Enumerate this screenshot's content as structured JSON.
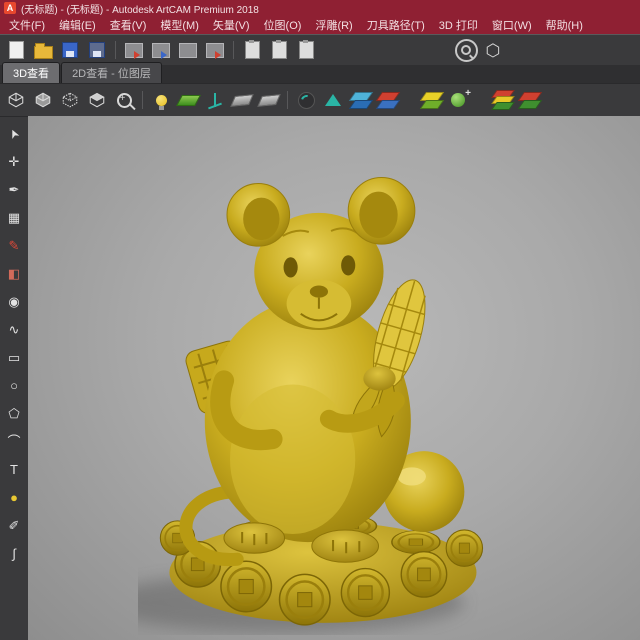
{
  "colors": {
    "titlebar": "#8f2033",
    "toolbar_bg": "#3a3a3c",
    "viewport_gray": "#a9a9a9",
    "model_gold": "#c9ac1f",
    "accent_red": "#d04030",
    "accent_teal": "#2ab5a5"
  },
  "title_bar": {
    "app_initial": "A",
    "title": "(无标题) - (无标题) - Autodesk ArtCAM Premium 2018"
  },
  "menu": {
    "items": [
      "文件(F)",
      "编辑(E)",
      "查看(V)",
      "模型(M)",
      "矢量(V)",
      "位图(O)",
      "浮雕(R)",
      "刀具路径(T)",
      "3D 打印",
      "窗口(W)",
      "帮助(H)"
    ]
  },
  "toolbar_main": {
    "icons": [
      "new-model",
      "open-model",
      "save-model",
      "save-as",
      "model-transfer",
      "relief-import",
      "relief-export",
      "paste-relief",
      "clipboard-copy",
      "clipboard-paste",
      "clipboard-preview",
      "zoom-tool",
      "material-hexagon"
    ]
  },
  "tab_bar": {
    "tabs": [
      {
        "label": "3D查看"
      },
      {
        "label": "2D查看 - 位图层"
      }
    ]
  },
  "toolbar_3d": {
    "icons": [
      "iso-cube-1",
      "iso-cube-2",
      "iso-cube-3",
      "iso-cube-4",
      "zoom-objects",
      "draft-bulb",
      "relief-plane",
      "origin-axes",
      "iso-plane-1",
      "iso-plane-2",
      "rotate-orbit",
      "teal-triangle",
      "layers-blue",
      "layers-red-blue",
      "layers-yellow-green",
      "sphere-add",
      "stack-multicolor",
      "layers-red-green"
    ]
  },
  "tool_palette": {
    "tools": [
      {
        "name": "select-cursor",
        "glyph": "➤"
      },
      {
        "name": "node-edit",
        "glyph": "✛"
      },
      {
        "name": "measure-pen",
        "glyph": "✒"
      },
      {
        "name": "mesh-grid",
        "glyph": "▦"
      },
      {
        "name": "sculpt-pencil",
        "glyph": "✎"
      },
      {
        "name": "eraser",
        "glyph": "◧"
      },
      {
        "name": "smudge",
        "glyph": "◉"
      },
      {
        "name": "freehand-select",
        "glyph": "∿"
      },
      {
        "name": "rectangle-tool",
        "glyph": "▭"
      },
      {
        "name": "ellipse-tool",
        "glyph": "○"
      },
      {
        "name": "polygon-tool",
        "glyph": "⬠"
      },
      {
        "name": "arc-tool",
        "glyph": "⌒"
      },
      {
        "name": "text-tool",
        "glyph": "T"
      },
      {
        "name": "droplet-tool",
        "glyph": "●"
      },
      {
        "name": "brush-tool",
        "glyph": "✐"
      },
      {
        "name": "spline-tool",
        "glyph": "∫"
      }
    ]
  },
  "viewport": {
    "model": "golden-zodiac-rat-statue-on-coins"
  }
}
